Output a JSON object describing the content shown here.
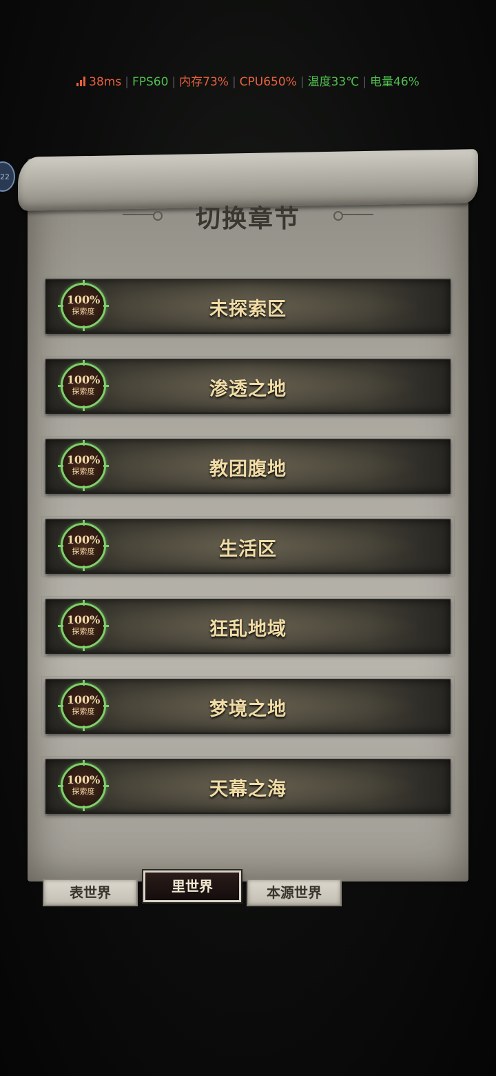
{
  "stats": {
    "ping": "38ms",
    "fps": "FPS60",
    "memory": "内存73%",
    "cpu": "CPU650%",
    "temperature": "温度33℃",
    "battery": "电量46%"
  },
  "colors": {
    "ping": "#e8603c",
    "fps": "#4fbf4f",
    "memory": "#e8603c",
    "cpu": "#e8603c",
    "temperature": "#4fbf4f",
    "battery": "#4fbf4f",
    "badge_ring": "#7fd06a",
    "chapter_text": "#f1dca6"
  },
  "float_ball_text": "22",
  "panel": {
    "title": "切换章节"
  },
  "chapters": [
    {
      "name": "未探索区",
      "percent": "100%",
      "label": "探索度"
    },
    {
      "name": "渗透之地",
      "percent": "100%",
      "label": "探索度"
    },
    {
      "name": "教团腹地",
      "percent": "100%",
      "label": "探索度"
    },
    {
      "name": "生活区",
      "percent": "100%",
      "label": "探索度"
    },
    {
      "name": "狂乱地域",
      "percent": "100%",
      "label": "探索度"
    },
    {
      "name": "梦境之地",
      "percent": "100%",
      "label": "探索度"
    },
    {
      "name": "天幕之海",
      "percent": "100%",
      "label": "探索度"
    }
  ],
  "tabs": [
    {
      "label": "表世界",
      "active": false
    },
    {
      "label": "里世界",
      "active": true
    },
    {
      "label": "本源世界",
      "active": false
    }
  ]
}
